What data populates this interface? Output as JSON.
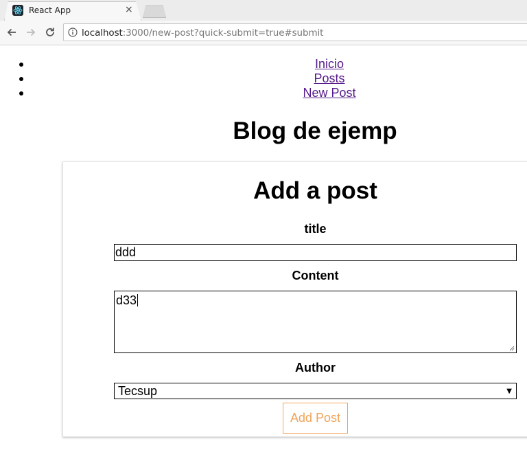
{
  "browser": {
    "tab_title": "React App",
    "close_glyph": "×",
    "url_host": "localhost",
    "url_rest": ":3000/new-post?quick-submit=true#submit",
    "icons": [
      "react-favicon-icon",
      "back-arrow-icon",
      "forward-arrow-icon",
      "reload-icon",
      "info-icon",
      "close-icon"
    ]
  },
  "nav": {
    "items": [
      {
        "label": "Inicio"
      },
      {
        "label": "Posts"
      },
      {
        "label": "New Post"
      }
    ]
  },
  "page": {
    "heading": "Blog de ejemp"
  },
  "form": {
    "heading": "Add a post",
    "title_label": "title",
    "title_value": "ddd",
    "content_label": "Content",
    "content_value": "d33",
    "author_label": "Author",
    "author_selected": "Tecsup",
    "submit_label": "Add Post",
    "accent_color": "#f0a35a"
  },
  "colors": {
    "link": "#551a8b",
    "button_accent": "#f0a35a"
  }
}
